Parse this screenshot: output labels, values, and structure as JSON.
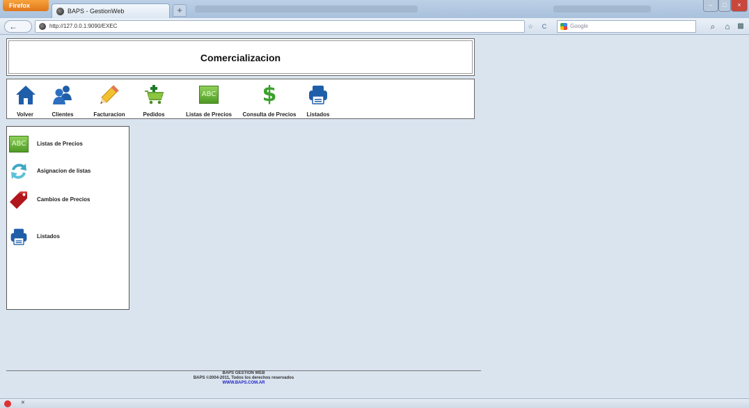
{
  "browser": {
    "app_button": "Firefox",
    "tab_title": "BAPS - GestionWeb",
    "new_tab": "+",
    "url": "http://127.0.0.1:9090/EXEC",
    "nav_back": "←",
    "search_placeholder": "Google",
    "reload": "C",
    "bookmark_star": "☆",
    "home": "⌂",
    "search_btn": "⌕",
    "close_status": "×"
  },
  "header": {
    "title": "Comercializacion"
  },
  "toolbar": {
    "items": [
      {
        "label": "Volver",
        "icon": "home-icon"
      },
      {
        "label": "Clientes",
        "icon": "users-icon"
      },
      {
        "label": "Facturacion",
        "icon": "pencil-icon"
      },
      {
        "label": "Pedidos",
        "icon": "cart-icon"
      },
      {
        "label": "Listas de Precios",
        "icon": "abc-icon",
        "icon_text": "ABC"
      },
      {
        "label": "Consulta de Precios",
        "icon": "dollar-icon",
        "icon_text": "$"
      },
      {
        "label": "Listados",
        "icon": "printer-icon"
      }
    ]
  },
  "sidemenu": {
    "items": [
      {
        "label": "Listas de Precios",
        "icon": "abc-icon",
        "icon_text": "ABC"
      },
      {
        "label": "Asignacion de listas",
        "icon": "refresh-icon"
      },
      {
        "label": "Cambios de Precios",
        "icon": "price-tag-icon"
      },
      {
        "label": "Listados",
        "icon": "printer-icon"
      }
    ]
  },
  "footer": {
    "line1": "BAPS GESTION WEB",
    "line2": "BAPS ©2004-2011, Todos los derechos reservados",
    "link": "WWW.BAPS.COM.AR"
  },
  "colors": {
    "page_bg": "#d9e4ef",
    "icon_blue": "#1f5ea8",
    "dollar_green": "#3aa12c",
    "tag_red": "#b0161b"
  }
}
